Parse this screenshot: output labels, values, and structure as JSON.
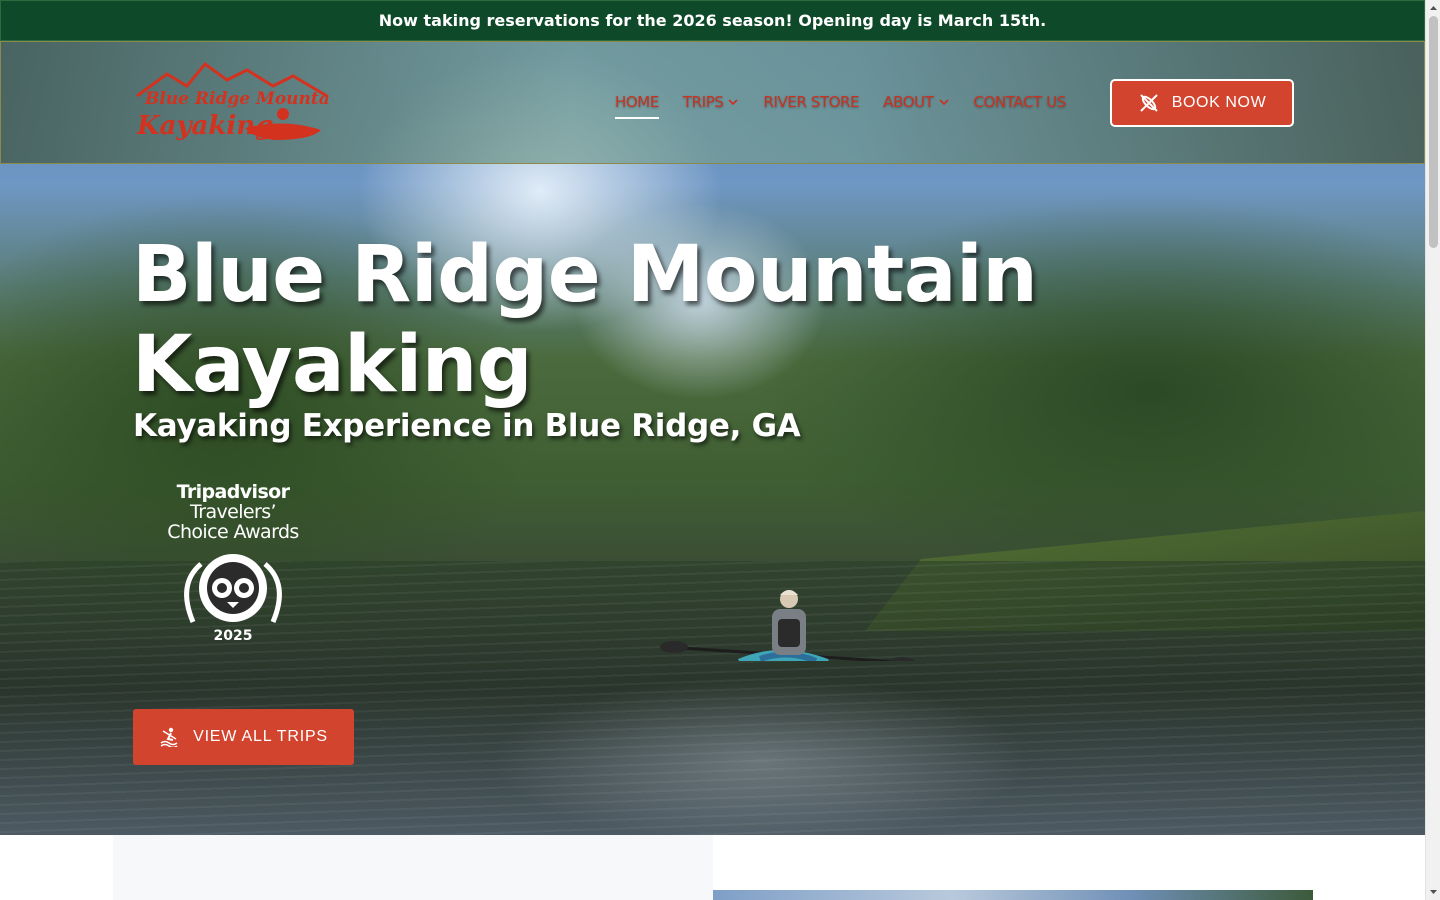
{
  "announcement": {
    "text": "Now taking reservations for the 2026 season! Opening day is March 15th."
  },
  "header": {
    "logo": {
      "line1": "Blue Ridge Mountain",
      "line2": "Kayaking"
    },
    "nav": [
      {
        "label": "HOME",
        "active": true,
        "has_dropdown": false
      },
      {
        "label": "TRIPS",
        "active": false,
        "has_dropdown": true
      },
      {
        "label": "RIVER STORE",
        "active": false,
        "has_dropdown": false
      },
      {
        "label": "ABOUT",
        "active": false,
        "has_dropdown": true
      },
      {
        "label": "CONTACT US",
        "active": false,
        "has_dropdown": false
      }
    ],
    "book_button": {
      "label": "BOOK NOW",
      "icon": "kayak-paddle-icon"
    }
  },
  "hero": {
    "title": "Blue Ridge Mountain Kayaking",
    "subtitle": "Kayaking Experience in Blue Ridge, GA",
    "award": {
      "brand": "Tripadvisor",
      "line1": "Travelers’",
      "line2": "Choice Awards",
      "year": "2025",
      "icon": "tripadvisor-owl-icon"
    },
    "cta": {
      "label": "VIEW ALL TRIPS",
      "icon": "kayaker-icon"
    }
  },
  "colors": {
    "announcement_bg": "#0e4a2a",
    "accent": "#d2442d",
    "nav_text": "#c8311f"
  }
}
